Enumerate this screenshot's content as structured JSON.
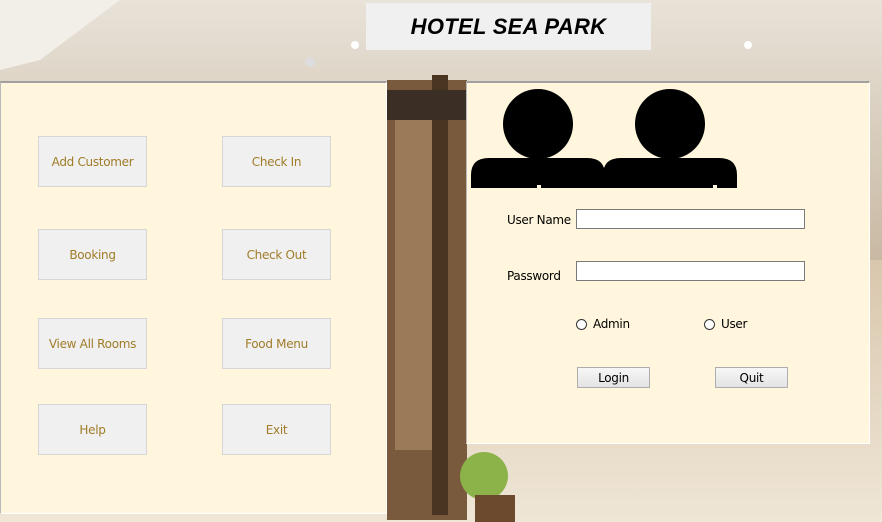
{
  "header": {
    "title": "HOTEL SEA PARK"
  },
  "menu": {
    "buttons": [
      {
        "id": "add-customer",
        "label": "Add Customer"
      },
      {
        "id": "check-in",
        "label": "Check In"
      },
      {
        "id": "booking",
        "label": "Booking"
      },
      {
        "id": "check-out",
        "label": "Check Out"
      },
      {
        "id": "view-all-rooms",
        "label": "View All Rooms"
      },
      {
        "id": "food-menu",
        "label": "Food Menu"
      },
      {
        "id": "help",
        "label": "Help"
      },
      {
        "id": "exit",
        "label": "Exit"
      }
    ]
  },
  "login": {
    "icon": "users-icon",
    "username_label": "User Name",
    "username_value": "",
    "password_label": "Password",
    "password_value": "",
    "role_admin_label": "Admin",
    "role_user_label": "User",
    "login_button": "Login",
    "quit_button": "Quit"
  },
  "colors": {
    "panel_bg": "#fff6dd",
    "menu_text": "#a07c28",
    "button_bg": "#f0f0f0"
  }
}
